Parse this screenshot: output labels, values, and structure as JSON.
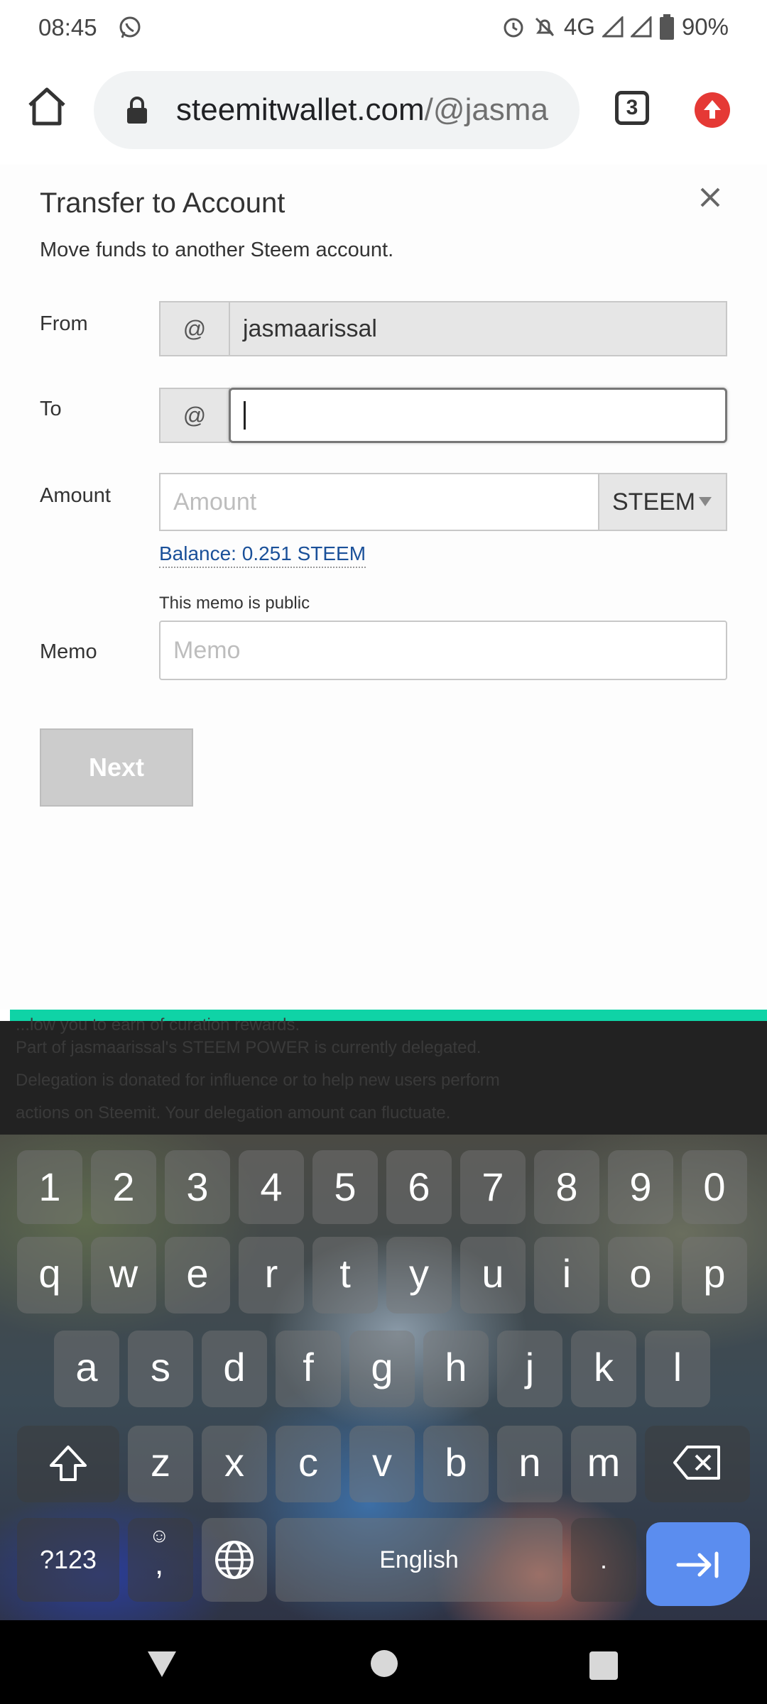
{
  "status_bar": {
    "time": "08:45",
    "network": "4G",
    "battery": "90%",
    "icons": [
      "whatsapp-icon",
      "alarm-icon",
      "notifications-off-icon",
      "signal-icon",
      "battery-icon"
    ]
  },
  "browser": {
    "url_host": "steemitwallet.com",
    "url_path": "/@jasma",
    "tab_count": "3"
  },
  "modal": {
    "title": "Transfer to Account",
    "subtitle": "Move funds to another Steem account.",
    "from": {
      "label": "From",
      "prefix": "@",
      "value": "jasmaarissal"
    },
    "to": {
      "label": "To",
      "prefix": "@",
      "value": ""
    },
    "amount": {
      "label": "Amount",
      "placeholder": "Amount",
      "asset": "STEEM"
    },
    "balance": "Balance: 0.251 STEEM",
    "memo_note": "This memo is public",
    "memo": {
      "label": "Memo",
      "placeholder": "Memo"
    },
    "next_label": "Next"
  },
  "background_page": {
    "line_top": "...low you to earn of curation rewards.",
    "line1": "Part of jasmaarissal's STEEM POWER is currently delegated.",
    "line2": "Delegation is donated for influence or to help new users perform",
    "line3": "actions on Steemit. Your delegation amount can fluctuate."
  },
  "keyboard": {
    "numbers": [
      "1",
      "2",
      "3",
      "4",
      "5",
      "6",
      "7",
      "8",
      "9",
      "0"
    ],
    "row1": [
      "q",
      "w",
      "e",
      "r",
      "t",
      "y",
      "u",
      "i",
      "o",
      "p"
    ],
    "row2": [
      "a",
      "s",
      "d",
      "f",
      "g",
      "h",
      "j",
      "k",
      "l"
    ],
    "row3": [
      "z",
      "x",
      "c",
      "v",
      "b",
      "n",
      "m"
    ],
    "symbols_label": "?123",
    "comma_label": ",",
    "space_label": "English",
    "period_label": "."
  },
  "colors": {
    "accent_teal": "#0fd3a6",
    "link_blue": "#1a5099",
    "update_red": "#e53935",
    "enter_blue": "#5b8def"
  }
}
